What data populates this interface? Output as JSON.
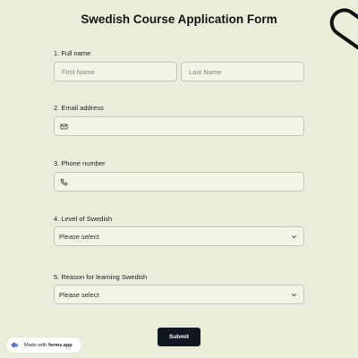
{
  "form": {
    "title": "Swedish Course Application Form",
    "fields": {
      "full_name": {
        "label": "1.  Full name",
        "first_placeholder": "First Name",
        "last_placeholder": "Last Name"
      },
      "email": {
        "label": "2. Email address",
        "icon": "mail-icon"
      },
      "phone": {
        "label": "3. Phone number",
        "icon": "phone-icon"
      },
      "level": {
        "label": "4. Level of Swedish",
        "selected": "Please select"
      },
      "reason": {
        "label": "5. Reason for learning Swedish",
        "selected": "Please select"
      }
    },
    "submit_label": "Submit"
  },
  "badge": {
    "made_with": "Made with",
    "brand": "forms.app"
  },
  "colors": {
    "background": "#e9edd9",
    "field_bg": "#f2f5e6",
    "field_border": "#c3c9b3",
    "submit_bg": "#101522",
    "logo_accent": "#6b5bd6"
  }
}
